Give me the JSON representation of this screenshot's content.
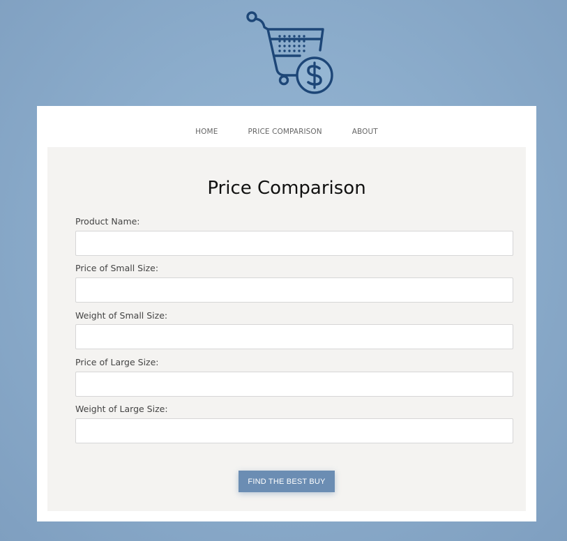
{
  "logo": {
    "icon": "shopping-cart-dollar-icon",
    "color": "#1d4677"
  },
  "nav": [
    {
      "label": "HOME"
    },
    {
      "label": "PRICE COMPARISON"
    },
    {
      "label": "ABOUT"
    }
  ],
  "form": {
    "title": "Price Comparison",
    "fields": [
      {
        "label": "Product Name:",
        "value": "",
        "placeholder": ""
      },
      {
        "label": "Price of Small Size:",
        "value": "",
        "placeholder": ""
      },
      {
        "label": "Weight of Small Size:",
        "value": "",
        "placeholder": ""
      },
      {
        "label": "Price of Large Size:",
        "value": "",
        "placeholder": ""
      },
      {
        "label": "Weight of Large Size:",
        "value": "",
        "placeholder": ""
      }
    ],
    "submit_label": "FIND THE BEST BUY"
  },
  "colors": {
    "accent": "#6b8db3",
    "background": "#8fb0cf",
    "panel": "#f4f3f1"
  }
}
